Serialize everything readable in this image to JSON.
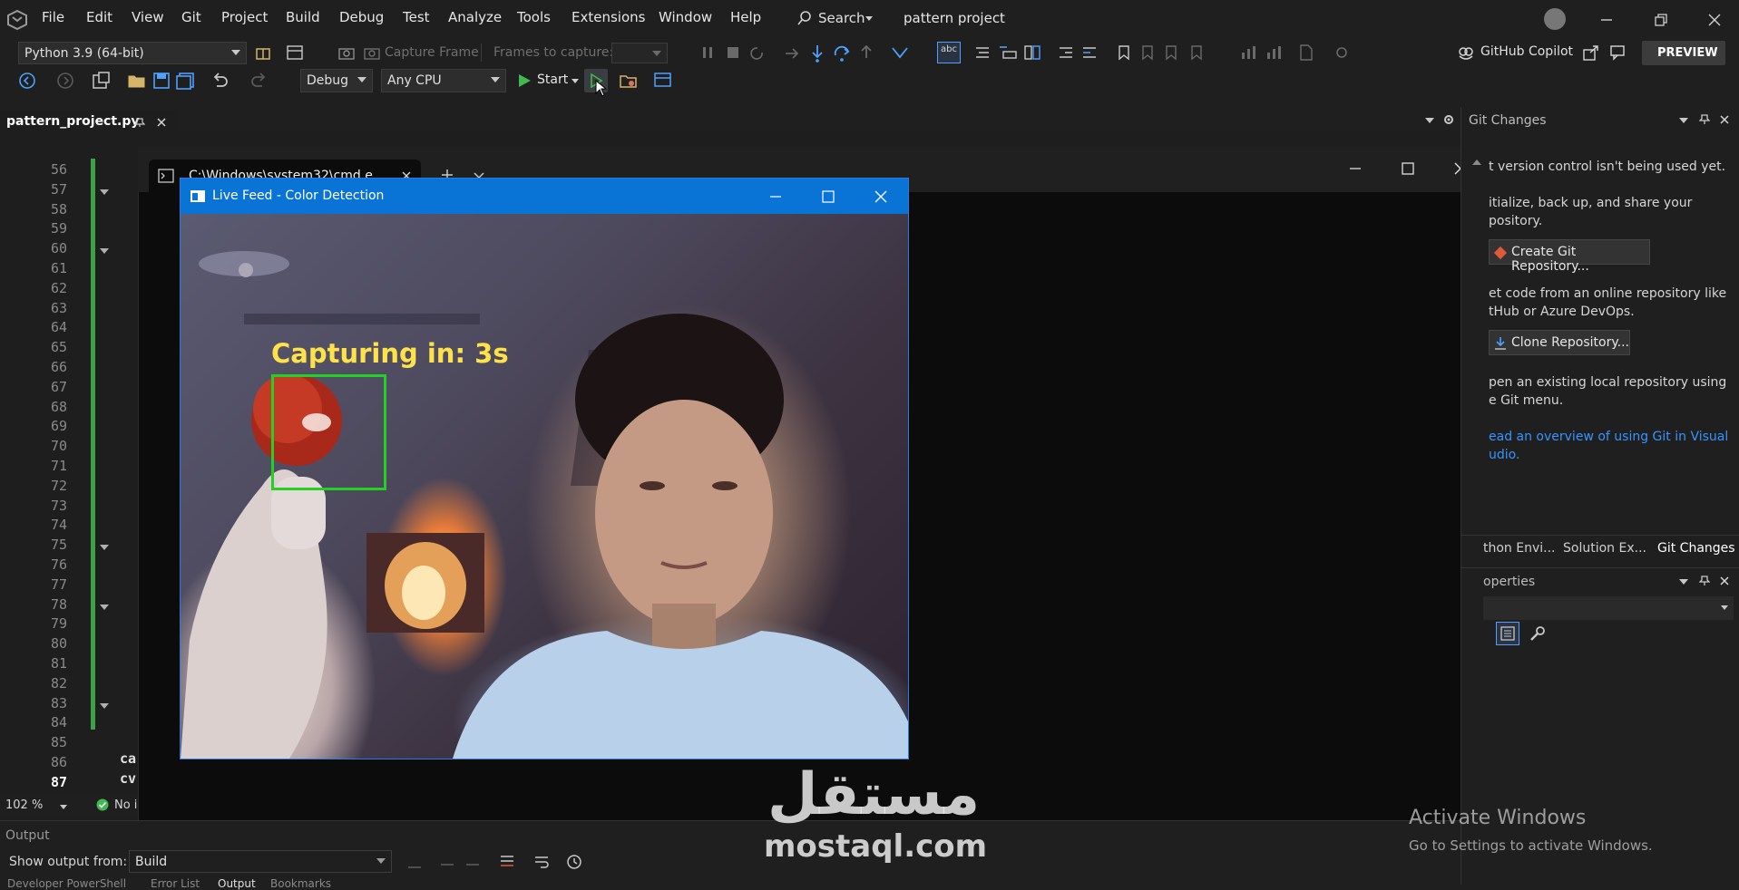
{
  "menu": [
    "File",
    "Edit",
    "View",
    "Git",
    "Project",
    "Build",
    "Debug",
    "Test",
    "Analyze",
    "Tools",
    "Extensions",
    "Window",
    "Help"
  ],
  "search_label": "Search",
  "solution_title": "pattern project",
  "toolbar": {
    "python_env": "Python 3.9 (64-bit)",
    "capture_frame": "Capture Frame",
    "frames_to_capture": "Frames to capture:",
    "config": "Debug",
    "platform": "Any CPU",
    "start": "Start",
    "copilot": "GitHub Copilot",
    "preview": "PREVIEW"
  },
  "editor": {
    "tab_name": "pattern_project.py",
    "line_numbers": [
      "56",
      "57",
      "58",
      "59",
      "60",
      "61",
      "62",
      "63",
      "64",
      "65",
      "66",
      "67",
      "68",
      "69",
      "70",
      "71",
      "72",
      "73",
      "74",
      "75",
      "76",
      "77",
      "78",
      "79",
      "80",
      "81",
      "82",
      "83",
      "84",
      "85",
      "86",
      "87"
    ],
    "code_fragments": [
      "ca",
      "cv"
    ],
    "zoom": "102 %",
    "issues": "No i"
  },
  "terminal": {
    "tab_title": "C:\\Windows\\system32\\cmd.e"
  },
  "live_feed": {
    "title": "Live Feed - Color Detection",
    "overlay_text": "Capturing in: 3s"
  },
  "git_panel": {
    "title": "Git Changes",
    "line1": "t version control isn't being used yet.",
    "line2a": "itialize, back up, and share your",
    "line2b": "pository.",
    "create_btn": "Create Git Repository...",
    "line3a": "et code from an online repository like",
    "line3b": "tHub or Azure DevOps.",
    "clone_btn": "Clone Repository...",
    "line4a": "pen an existing local repository using",
    "line4b": "e Git menu.",
    "link_a": "ead an overview of using Git in Visual",
    "link_b": "udio.",
    "tabs": [
      "thon Envi...",
      "Solution Ex...",
      "Git Changes"
    ],
    "properties": "operties"
  },
  "output": {
    "title": "Output",
    "show_from_label": "Show output from:",
    "show_from_value": "Build",
    "bottom_tabs": [
      "Developer PowerShell",
      "Error List",
      "Output",
      "Bookmarks"
    ]
  },
  "watermark": {
    "arabic": "مستقل",
    "latin": "mostaql.com"
  },
  "activate": {
    "title": "Activate Windows",
    "subtitle": "Go to Settings to activate Windows."
  }
}
